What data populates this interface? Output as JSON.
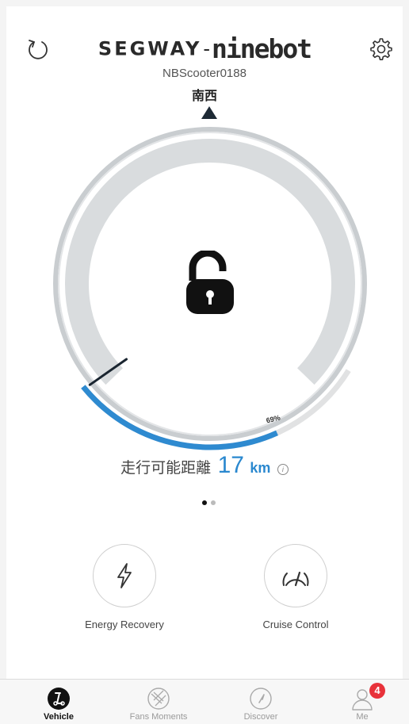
{
  "header": {
    "brand_left": "SEGWAY",
    "brand_dash": "-",
    "brand_right": "ninebot",
    "device_name": "NBScooter0188",
    "heading_text": "南西",
    "refresh_icon": "refresh-icon",
    "settings_icon": "gear-icon"
  },
  "gauge": {
    "battery_percent": 69,
    "battery_percent_label": "69%",
    "lock_icon": "unlocked-padlock-icon",
    "colors": {
      "battery": "#2e8ad0",
      "track": "#e0e2e4",
      "ring": "#c9cdd0"
    }
  },
  "range": {
    "label": "走行可能距離",
    "value": "17",
    "unit": "km",
    "info_icon": "i"
  },
  "pager": {
    "pages": 2,
    "active": 0
  },
  "features": [
    {
      "label": "Energy Recovery",
      "icon": "lightning-icon"
    },
    {
      "label": "Cruise Control",
      "icon": "speedometer-icon"
    }
  ],
  "tabbar": {
    "tabs": [
      {
        "label": "Vehicle",
        "icon": "scooter-icon",
        "active": true
      },
      {
        "label": "Fans Moments",
        "icon": "aperture-icon",
        "active": false
      },
      {
        "label": "Discover",
        "icon": "compass-icon",
        "active": false
      },
      {
        "label": "Me",
        "icon": "user-icon",
        "active": false,
        "badge": "4"
      }
    ]
  }
}
